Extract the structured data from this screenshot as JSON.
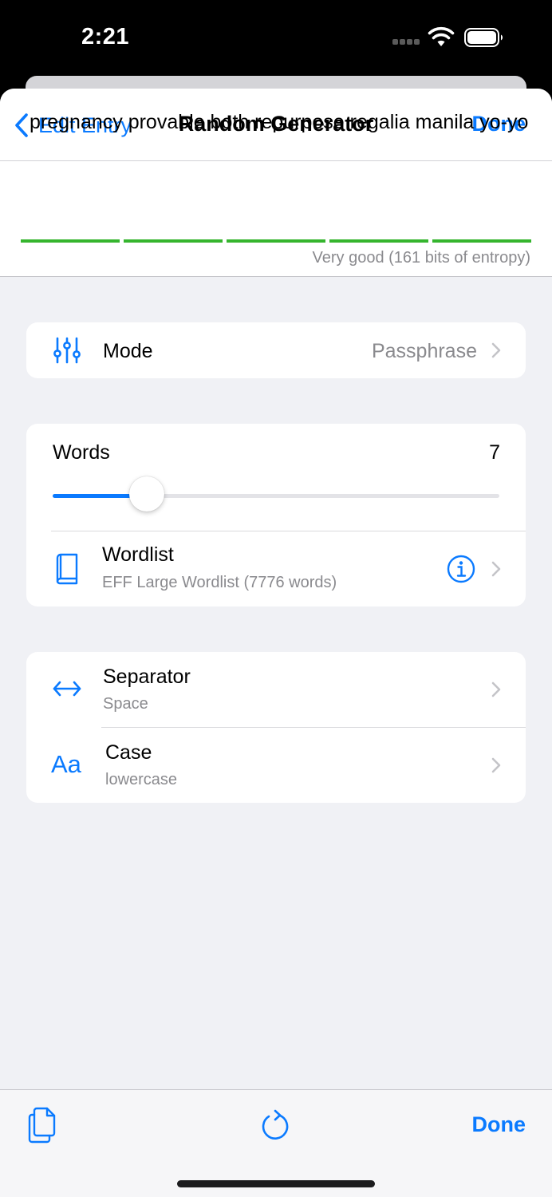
{
  "status_bar": {
    "time": "2:21",
    "icons": [
      "cellular-signal-icon",
      "wifi-icon",
      "battery-icon"
    ]
  },
  "nav": {
    "back_label": "Edit Entry",
    "title": "Random Generator",
    "done_label": "Done"
  },
  "generated": {
    "password": "pregnancy provable both repurpose regalia manila yo-yo",
    "strength_label": "Very good (161 bits of entropy)",
    "strength_segments_filled": 5,
    "strength_segments_total": 5,
    "strength_color": "#35b52e"
  },
  "mode": {
    "icon": "sliders-icon",
    "label": "Mode",
    "value": "Passphrase"
  },
  "words": {
    "label": "Words",
    "value": "7",
    "slider_fraction": 0.21
  },
  "wordlist": {
    "icon": "book-icon",
    "label": "Wordlist",
    "subtitle": "EFF Large Wordlist (7776 words)",
    "info_icon": "info-circle-icon"
  },
  "separator": {
    "icon": "arrows-left-right-icon",
    "label": "Separator",
    "value": "Space"
  },
  "case": {
    "icon_text": "Aa",
    "label": "Case",
    "value": "lowercase"
  },
  "toolbar": {
    "copy_icon": "copy-icon",
    "regenerate_icon": "refresh-icon",
    "done_label": "Done"
  },
  "colors": {
    "accent": "#0a7aff",
    "background": "#f0f1f5",
    "secondary_text": "#8a8a8e"
  }
}
